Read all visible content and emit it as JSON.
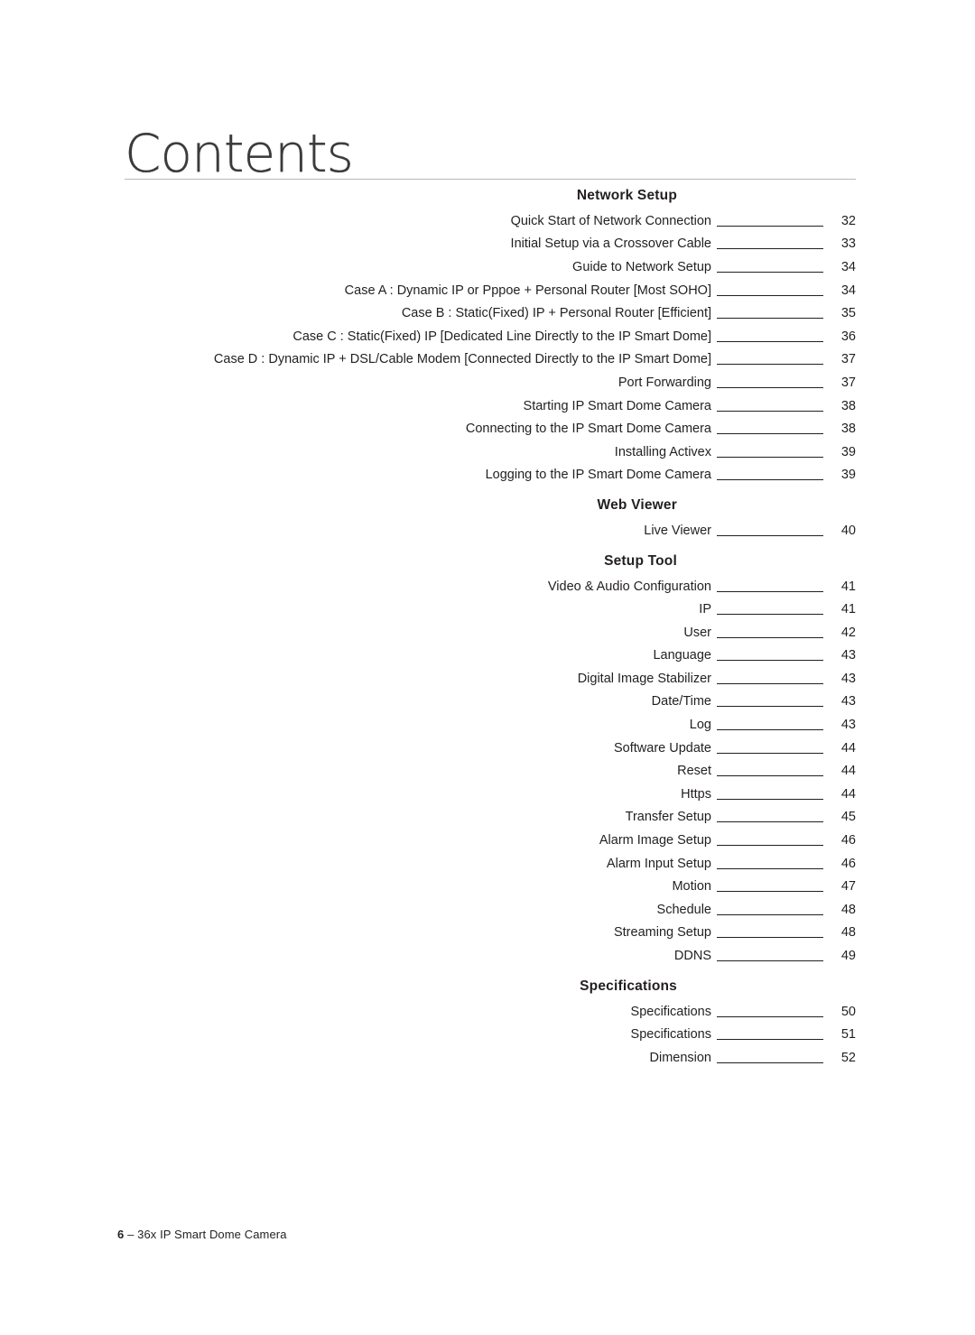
{
  "page_title": "Contents",
  "footer": {
    "page_number": "6",
    "dash": "–",
    "doc_title": "36x IP Smart Dome Camera"
  },
  "sections": [
    {
      "heading": "Network Setup",
      "entries": [
        {
          "label": "Quick Start of Network Connection",
          "page": "32"
        },
        {
          "label": "Initial Setup via a Crossover Cable",
          "page": "33"
        },
        {
          "label": "Guide to Network Setup",
          "page": "34"
        },
        {
          "label": "Case A : Dynamic IP or Pppoe + Personal Router [Most SOHO]",
          "page": "34"
        },
        {
          "label": "Case B : Static(Fixed) IP + Personal Router [Efficient]",
          "page": "35"
        },
        {
          "label": "Case C : Static(Fixed) IP [Dedicated Line Directly to the IP Smart Dome]",
          "page": "36"
        },
        {
          "label": "Case D : Dynamic IP + DSL/Cable Modem [Connected Directly to the IP Smart Dome]",
          "page": "37"
        },
        {
          "label": "Port Forwarding",
          "page": "37"
        },
        {
          "label": "Starting IP Smart Dome Camera",
          "page": "38"
        },
        {
          "label": "Connecting to the IP Smart Dome Camera",
          "page": "38"
        },
        {
          "label": "Installing Activex",
          "page": "39"
        },
        {
          "label": "Logging to the IP Smart Dome Camera",
          "page": "39"
        }
      ]
    },
    {
      "heading": "Web Viewer",
      "entries": [
        {
          "label": "Live Viewer",
          "page": "40"
        }
      ]
    },
    {
      "heading": "Setup Tool",
      "entries": [
        {
          "label": "Video & Audio Configuration",
          "page": "41"
        },
        {
          "label": "IP",
          "page": "41"
        },
        {
          "label": "User",
          "page": "42"
        },
        {
          "label": "Language",
          "page": "43"
        },
        {
          "label": "Digital Image Stabilizer",
          "page": "43"
        },
        {
          "label": "Date/Time",
          "page": "43"
        },
        {
          "label": "Log",
          "page": "43"
        },
        {
          "label": "Software Update",
          "page": "44"
        },
        {
          "label": "Reset",
          "page": "44"
        },
        {
          "label": "Https",
          "page": "44"
        },
        {
          "label": "Transfer Setup",
          "page": "45"
        },
        {
          "label": "Alarm Image Setup",
          "page": "46"
        },
        {
          "label": "Alarm Input Setup",
          "page": "46"
        },
        {
          "label": "Motion",
          "page": "47"
        },
        {
          "label": "Schedule",
          "page": "48"
        },
        {
          "label": "Streaming Setup",
          "page": "48"
        },
        {
          "label": "DDNS",
          "page": "49"
        }
      ]
    },
    {
      "heading": "Specifications",
      "entries": [
        {
          "label": "Specifications",
          "page": "50"
        },
        {
          "label": "Specifications",
          "page": "51"
        },
        {
          "label": "Dimension",
          "page": "52"
        }
      ]
    }
  ]
}
